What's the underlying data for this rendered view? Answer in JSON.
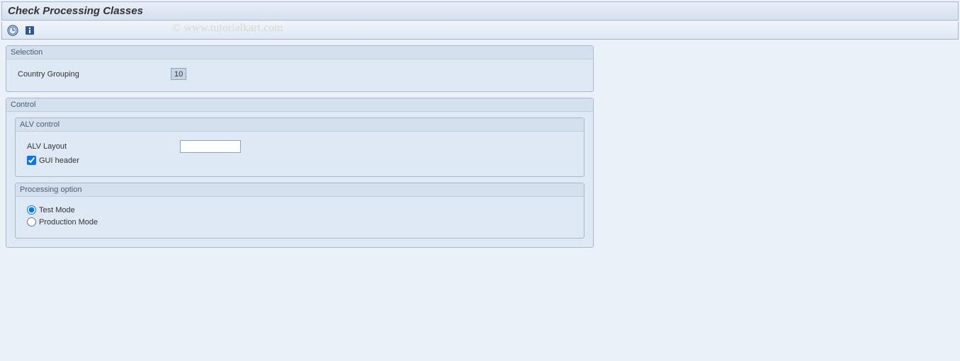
{
  "header": {
    "title": "Check Processing Classes"
  },
  "watermark": "© www.tutorialkart.com",
  "selection": {
    "title": "Selection",
    "country_grouping_label": "Country Grouping",
    "country_grouping_value": "10"
  },
  "control": {
    "title": "Control",
    "alv_control": {
      "title": "ALV control",
      "alv_layout_label": "ALV Layout",
      "alv_layout_value": "",
      "gui_header_label": "GUI header",
      "gui_header_checked": true
    },
    "processing_option": {
      "title": "Processing option",
      "test_mode_label": "Test Mode",
      "production_mode_label": "Production Mode",
      "selected": "test"
    }
  }
}
